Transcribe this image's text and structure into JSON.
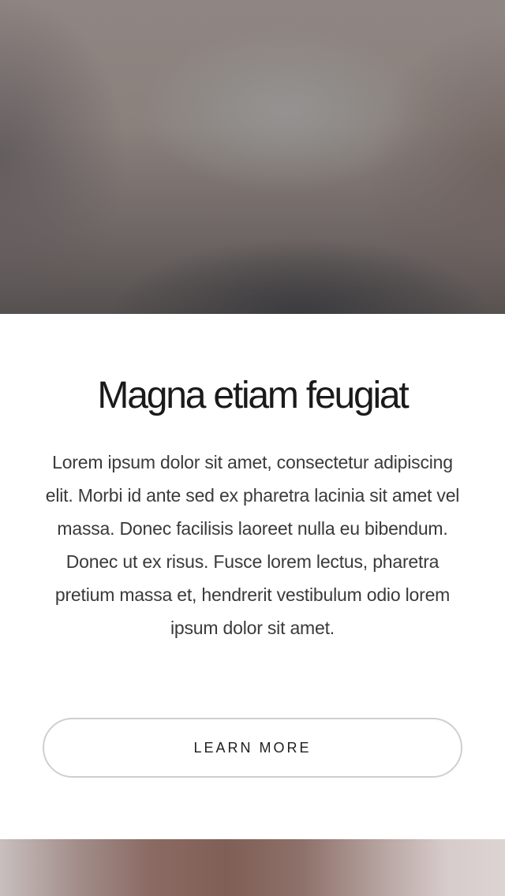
{
  "hero": {
    "image_description": ""
  },
  "section": {
    "title": "Magna etiam feugiat",
    "body": "Lorem ipsum dolor sit amet, consectetur adipiscing elit. Morbi id ante sed ex pharetra lacinia sit amet vel massa. Donec facilisis laoreet nulla eu bibendum. Donec ut ex risus. Fusce lorem lectus, pharetra pretium massa et, hendrerit vestibulum odio lorem ipsum dolor sit amet.",
    "button_label": "LEARN MORE"
  },
  "colors": {
    "title": "#1a1a1a",
    "body_text": "#3a3a3a",
    "button_border": "#cfcfcf",
    "background": "#ffffff"
  }
}
